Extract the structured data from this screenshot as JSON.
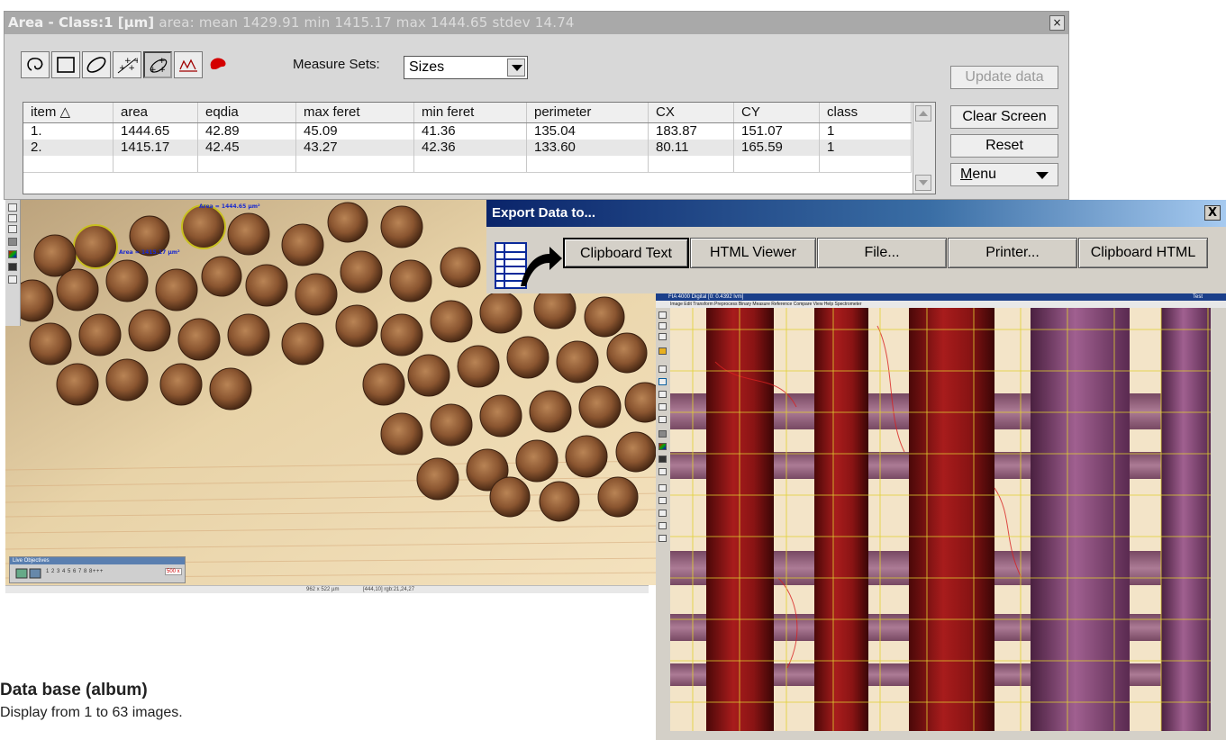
{
  "measure_window": {
    "title_prefix": "Area - Class:1 [µm]",
    "title_stats": "area:  mean 1429.91  min 1415.17  max 1444.65  stdev 14.74",
    "close_glyph": "×",
    "tools": [
      "lasso-tool-icon",
      "rectangle-tool-icon",
      "ellipse-tool-icon",
      "multi-point-tool-icon",
      "angled-points-tool-icon",
      "profile-tool-icon",
      "blob-tool-icon"
    ],
    "measure_sets_label": "Measure Sets:",
    "measure_sets_value": "Sizes",
    "buttons": {
      "update": "Update data",
      "clear": "Clear Screen",
      "reset": "Reset",
      "menu_first": "M",
      "menu_rest": "enu"
    },
    "table": {
      "columns": [
        "item  △",
        "area",
        "eqdia",
        "max feret",
        "min feret",
        "perimeter",
        "CX",
        "CY",
        "class"
      ],
      "rows": [
        [
          "1.",
          "1444.65",
          "42.89",
          "45.09",
          "41.36",
          "135.04",
          "183.87",
          "151.07",
          "1"
        ],
        [
          "2.",
          "1415.17",
          "42.45",
          "43.27",
          "42.36",
          "133.60",
          "80.11",
          "165.59",
          "1"
        ]
      ]
    }
  },
  "image1": {
    "annotation_1": "Area = 1444.65 µm²",
    "annotation_2": "Area = 1415.17 µm²",
    "live_panel_title": "Live Objectives",
    "live_numbers": "1  2  3  4  5  6  7  8  8+++",
    "live_zoom": "500 x",
    "status_left": "962 x 522 µm",
    "status_right": "[444,10] rgb:21,24,27",
    "colors": {
      "background": "#e9d5aa",
      "particle": "#8a5530",
      "selected_outline": "#c8c020"
    }
  },
  "export_dialog": {
    "title": "Export Data to...",
    "close_glyph": "X",
    "icon": "table-export-icon",
    "buttons": [
      "Clipboard Text",
      "HTML Viewer",
      "File...",
      "Printer...",
      "Clipboard HTML"
    ]
  },
  "image2": {
    "title": "FIA 4000 Digital   [0: 0.4392 lvm]",
    "version": "Test",
    "menu": "Image  Edit  Transform  Preprocess  Binary  Measure  Reference  Compare  View  Help  Spectrometer",
    "colors": {
      "red_fiber": "#8a1414",
      "purple_fiber": "#8a4a78",
      "grid": "#e0d030",
      "background": "#f3e4c8"
    }
  },
  "caption": {
    "title": "Data base (album)",
    "text": "Display from 1 to 63 images."
  }
}
